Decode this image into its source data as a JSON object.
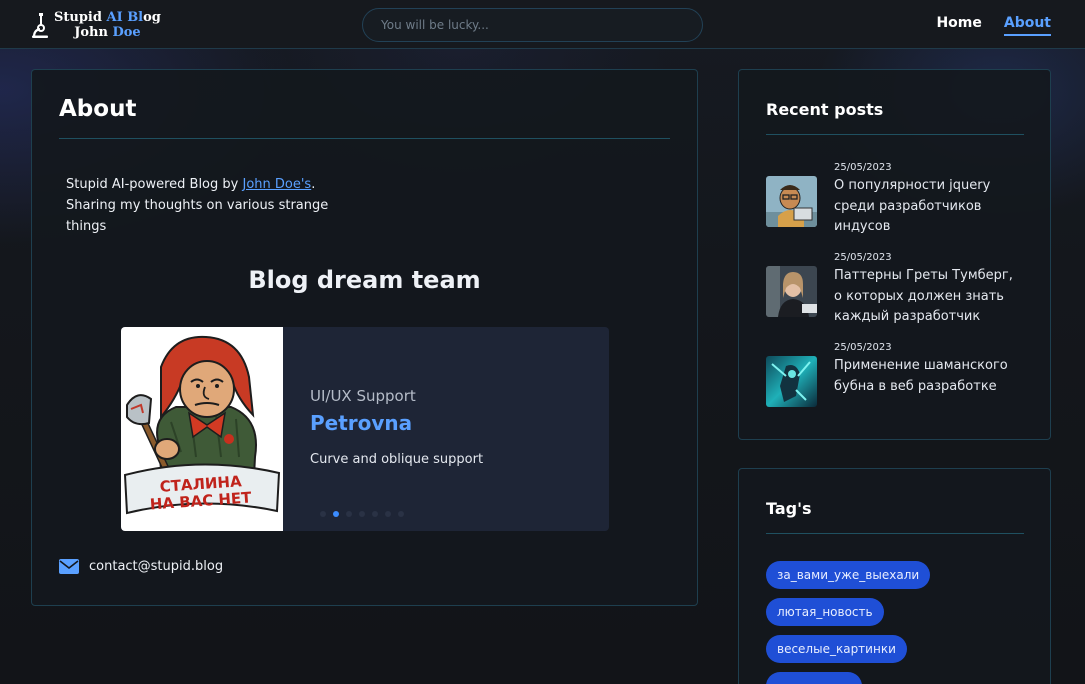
{
  "header": {
    "logo_line1_a": "Stupid ",
    "logo_line1_b": "AI Bl",
    "logo_line1_c": "og",
    "logo_line2_a": "John ",
    "logo_line2_b": "Doe",
    "search_placeholder": "You will be lucky...",
    "nav": [
      {
        "label": "Home",
        "active": false
      },
      {
        "label": "About",
        "active": true
      }
    ]
  },
  "main": {
    "title": "About",
    "intro_prefix": "Stupid AI-powered Blog by ",
    "intro_link": "John Doe's",
    "intro_suffix": ". Sharing my thoughts on various strange things",
    "team_title": "Blog dream team",
    "slide": {
      "role": "UI/UX Support",
      "name": "Petrovna",
      "description": "Curve and oblique support",
      "image_caption_line1": "СТАЛИНА",
      "image_caption_line2": "НА ВАС НЕТ",
      "dot_count": 7,
      "active_dot": 1
    },
    "contact_email": "contact@stupid.blog"
  },
  "sidebar": {
    "recent_title": "Recent posts",
    "posts": [
      {
        "date": "25/05/2023",
        "title": "О популярности jquery среди разработчиков индусов",
        "thumb": "cartoon-developer"
      },
      {
        "date": "25/05/2023",
        "title": "Паттерны Греты Тумберг, о которых должен знать каждый разработчик",
        "thumb": "woman-portrait"
      },
      {
        "date": "25/05/2023",
        "title": "Применение шаманского бубна в веб разработке",
        "thumb": "shaman-art"
      }
    ],
    "tags_title": "Tag's",
    "tags": [
      "за_вами_уже_выехали",
      "лютая_новость",
      "веселые_картинки"
    ]
  },
  "colors": {
    "accent": "#5aa0ff",
    "tag_bg": "#1f4fd6",
    "card_border": "#1e3f4f"
  }
}
